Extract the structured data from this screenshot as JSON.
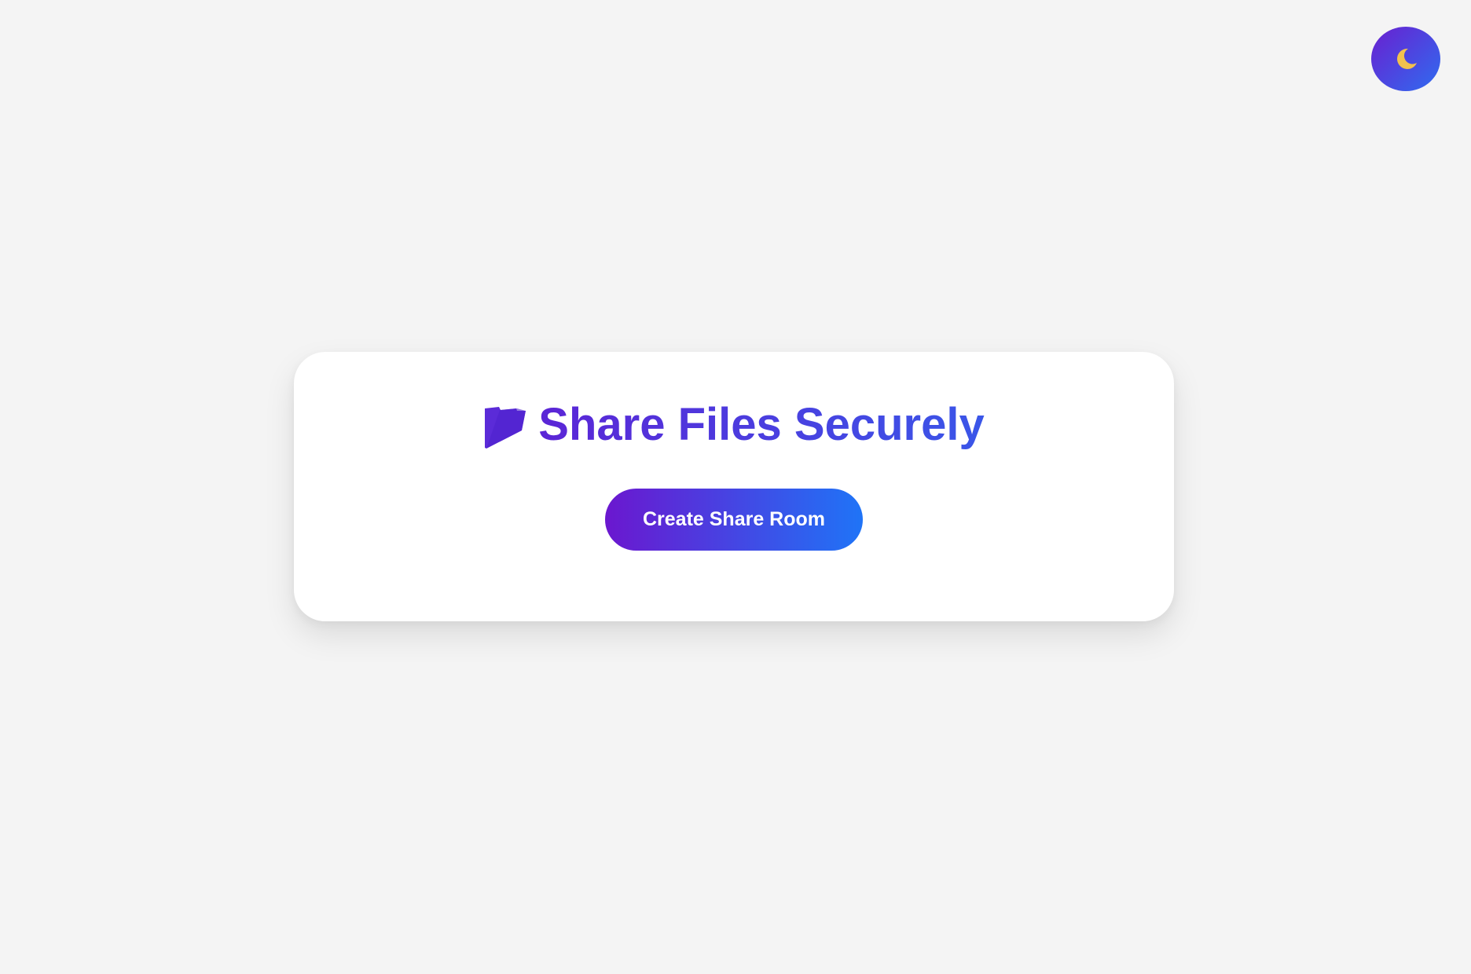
{
  "theme_toggle": {
    "icon": "moon-icon",
    "icon_color": "#f2c14e"
  },
  "card": {
    "icon": "folder-icon",
    "title": "Share Files Securely",
    "button_label": "Create Share Room"
  },
  "colors": {
    "background": "#f4f4f4",
    "accent_start": "#6a1fd0",
    "accent_end": "#1f74f7",
    "title": "#4a3ae0"
  }
}
